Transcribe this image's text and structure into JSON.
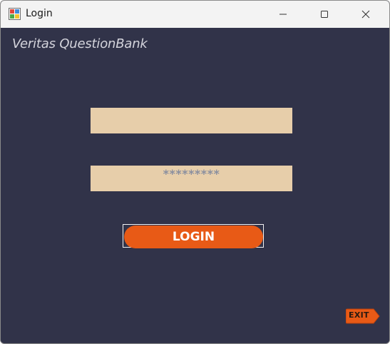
{
  "window": {
    "title": "Login",
    "icon": "winforms-app-icon",
    "controls": {
      "minimize": "minimize-icon",
      "maximize": "maximize-icon",
      "close": "close-icon"
    }
  },
  "form": {
    "brand": "Veritas QuestionBank",
    "username": {
      "value": ""
    },
    "password": {
      "masked_value": "*********"
    },
    "login_label": "LOGIN",
    "exit_label": "EXIT"
  },
  "colors": {
    "background": "#313349",
    "field": "#e7ceaa",
    "accent": "#e85a16",
    "titlebar": "#f3f3f3"
  }
}
